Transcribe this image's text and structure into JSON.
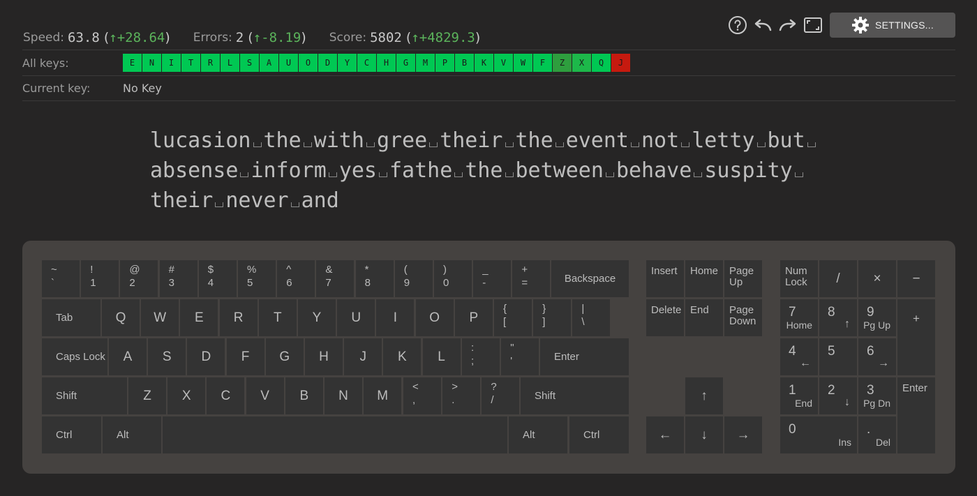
{
  "stats": {
    "speed_label": "Speed:",
    "speed_value": "63.8",
    "speed_delta": "↑+28.64",
    "errors_label": "Errors:",
    "errors_value": "2",
    "errors_delta": "↑-8.19",
    "score_label": "Score:",
    "score_value": "5802",
    "score_delta": "↑+4829.3"
  },
  "toolbar": {
    "settings_label": "SETTINGS..."
  },
  "all_keys": {
    "label": "All keys:",
    "keys": [
      {
        "k": "E",
        "color": "#00c853"
      },
      {
        "k": "N",
        "color": "#00c853"
      },
      {
        "k": "I",
        "color": "#00c853"
      },
      {
        "k": "T",
        "color": "#00c853"
      },
      {
        "k": "R",
        "color": "#00c853"
      },
      {
        "k": "L",
        "color": "#00c853"
      },
      {
        "k": "S",
        "color": "#00c853"
      },
      {
        "k": "A",
        "color": "#00c853"
      },
      {
        "k": "U",
        "color": "#00c853"
      },
      {
        "k": "O",
        "color": "#00c853"
      },
      {
        "k": "D",
        "color": "#00c853"
      },
      {
        "k": "Y",
        "color": "#00c853"
      },
      {
        "k": "C",
        "color": "#00c853"
      },
      {
        "k": "H",
        "color": "#00c853"
      },
      {
        "k": "G",
        "color": "#00c853"
      },
      {
        "k": "M",
        "color": "#00c853"
      },
      {
        "k": "P",
        "color": "#00c853"
      },
      {
        "k": "B",
        "color": "#00c853"
      },
      {
        "k": "K",
        "color": "#00c853"
      },
      {
        "k": "V",
        "color": "#00c853"
      },
      {
        "k": "W",
        "color": "#00c853"
      },
      {
        "k": "F",
        "color": "#00c853"
      },
      {
        "k": "Z",
        "color": "#2e9e3e"
      },
      {
        "k": "X",
        "color": "#1db84a"
      },
      {
        "k": "Q",
        "color": "#00c853"
      },
      {
        "k": "J",
        "color": "#c61a0f"
      }
    ]
  },
  "current_key": {
    "label": "Current key:",
    "value": "No Key"
  },
  "text_lines": [
    [
      "lucasion",
      "the",
      "with",
      "gree",
      "their",
      "the",
      "event",
      "not",
      "letty",
      "but",
      ""
    ],
    [
      "absense",
      "inform",
      "yes",
      "fathe",
      "the",
      "between",
      "behave",
      "suspity",
      ""
    ],
    [
      "their",
      "never",
      "and"
    ]
  ],
  "keyboard": {
    "row1": [
      [
        "~",
        "`"
      ],
      [
        "!",
        "1"
      ],
      [
        "@",
        "2"
      ],
      [
        "#",
        "3"
      ],
      [
        "$",
        "4"
      ],
      [
        "%",
        "5"
      ],
      [
        "^",
        "6"
      ],
      [
        "&",
        "7"
      ],
      [
        "*",
        "8"
      ],
      [
        "(",
        "9"
      ],
      [
        ")",
        "0"
      ],
      [
        "_",
        "-"
      ],
      [
        "+",
        "="
      ]
    ],
    "backspace": "Backspace",
    "tab": "Tab",
    "row2": [
      "Q",
      "W",
      "E",
      "R",
      "T",
      "Y",
      "U",
      "I",
      "O",
      "P"
    ],
    "row2_sym": [
      [
        "{",
        "["
      ],
      [
        "}",
        "]"
      ],
      [
        "|",
        "\\"
      ]
    ],
    "caps": "Caps Lock",
    "row3": [
      "A",
      "S",
      "D",
      "F",
      "G",
      "H",
      "J",
      "K",
      "L"
    ],
    "row3_sym": [
      [
        ":",
        ";"
      ],
      [
        "\"",
        "'"
      ]
    ],
    "enter": "Enter",
    "shift": "Shift",
    "row4": [
      "Z",
      "X",
      "C",
      "V",
      "B",
      "N",
      "M"
    ],
    "row4_sym": [
      [
        "<",
        ","
      ],
      [
        ">",
        "."
      ],
      [
        "?",
        "/"
      ]
    ],
    "ctrl": "Ctrl",
    "alt": "Alt",
    "nav": {
      "insert": "Insert",
      "home": "Home",
      "page_up": "Page Up",
      "delete": "Delete",
      "end": "End",
      "page_down": "Page Down"
    },
    "arrows": {
      "up": "↑",
      "down": "↓",
      "left": "←",
      "right": "→"
    },
    "numpad": {
      "numlock": "Num Lock",
      "slash": "/",
      "mult": "×",
      "minus": "−",
      "plus": "+",
      "enter": "Enter",
      "n7": "7",
      "n7s": "Home",
      "n8": "8",
      "n8s": "↑",
      "n9": "9",
      "n9s": "Pg Up",
      "n4": "4",
      "n4s": "←",
      "n5": "5",
      "n6": "6",
      "n6s": "→",
      "n1": "1",
      "n1s": "End",
      "n2": "2",
      "n2s": "↓",
      "n3": "3",
      "n3s": "Pg Dn",
      "n0": "0",
      "n0s": "Ins",
      "dot": ".",
      "dots": "Del"
    }
  }
}
